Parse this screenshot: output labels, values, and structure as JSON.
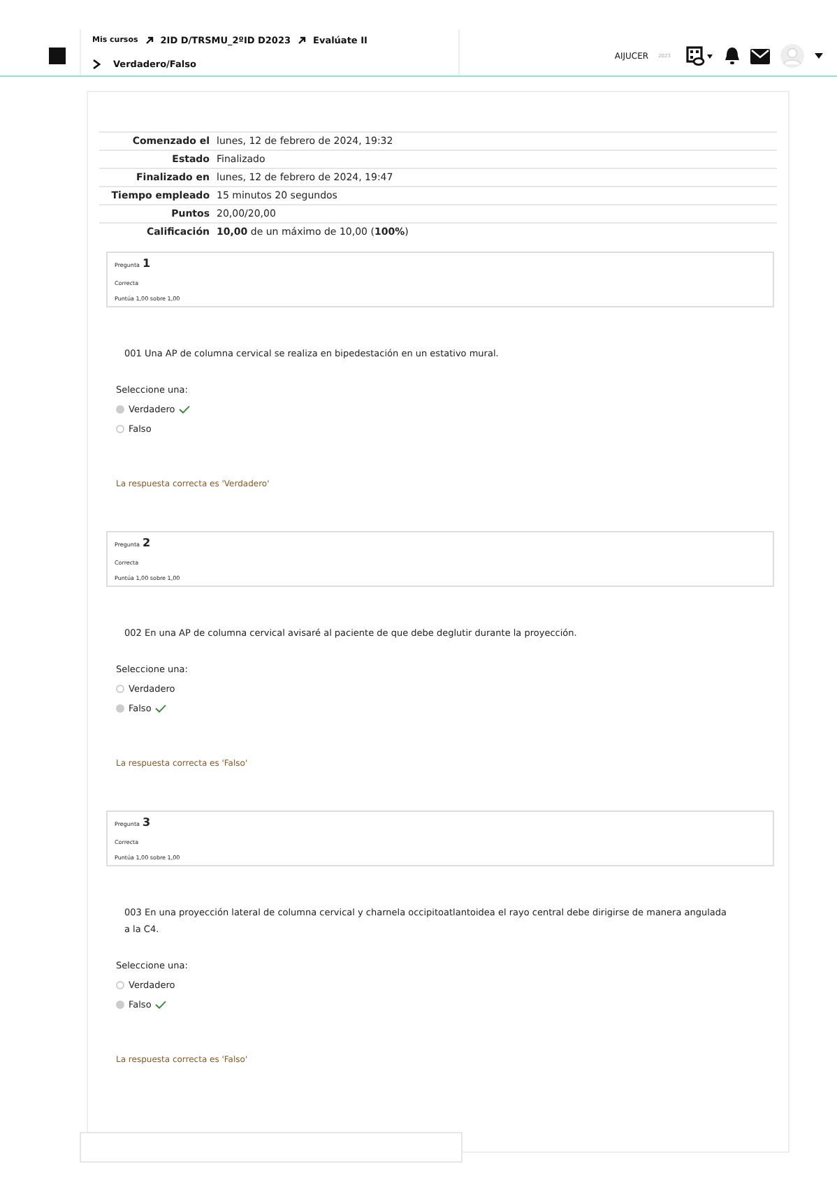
{
  "header": {
    "breadcrumb": [
      {
        "label": "Mis cursos"
      },
      {
        "label": "2ID D/TRSMU_2ºID D2023"
      },
      {
        "label": "Evalúate II"
      }
    ],
    "breadcrumb_last": "Verdadero/Falso",
    "user_name": "AIJUCER",
    "user_extra": "2023"
  },
  "summary": [
    {
      "label": "Comenzado el",
      "value": "lunes, 12 de febrero de 2024, 19:32"
    },
    {
      "label": "Estado",
      "value": "Finalizado"
    },
    {
      "label": "Finalizado en",
      "value": "lunes, 12 de febrero de 2024, 19:47"
    },
    {
      "label": "Tiempo empleado",
      "value": "15 minutos 20 segundos"
    },
    {
      "label": "Puntos",
      "value": "20,00/20,00"
    },
    {
      "label": "Calificación",
      "value": "**10,00** de un máximo de 10,00 (**100%**)"
    }
  ],
  "questions": [
    {
      "label": "Pregunta",
      "number": "1",
      "state": "Correcta",
      "points": "Puntúa 1,00 sobre 1,00",
      "text": "001 Una AP de columna cervical se realiza en bipedestación en un estativo mural.",
      "prompt": "Seleccione una:",
      "options": [
        {
          "label": "Verdadero",
          "selected": true,
          "correct": true
        },
        {
          "label": "Falso",
          "selected": false,
          "correct": false
        }
      ],
      "feedback": "La respuesta correcta es 'Verdadero'"
    },
    {
      "label": "Pregunta",
      "number": "2",
      "state": "Correcta",
      "points": "Puntúa 1,00 sobre 1,00",
      "text": "002 En una AP de columna cervical avisaré al paciente de que debe deglutir durante la proyección.",
      "prompt": "Seleccione una:",
      "options": [
        {
          "label": "Verdadero",
          "selected": false,
          "correct": false
        },
        {
          "label": "Falso",
          "selected": true,
          "correct": true
        }
      ],
      "feedback": "La respuesta correcta es 'Falso'"
    },
    {
      "label": "Pregunta",
      "number": "3",
      "state": "Correcta",
      "points": "Puntúa 1,00 sobre 1,00",
      "text": "003 En una proyección lateral de columna cervical y charnela occipitoatlantoidea el rayo central debe dirigirse de manera angulada a la C4.",
      "prompt": "Seleccione una:",
      "options": [
        {
          "label": "Verdadero",
          "selected": false,
          "correct": false
        },
        {
          "label": "Falso",
          "selected": true,
          "correct": true
        }
      ],
      "feedback": "La respuesta correcta es 'Falso'"
    }
  ]
}
